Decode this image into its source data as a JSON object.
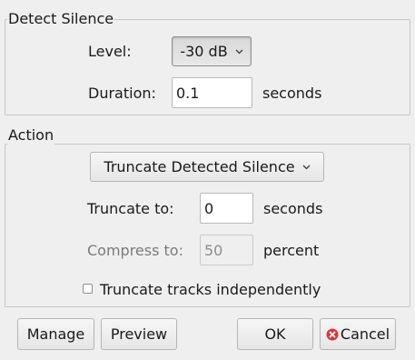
{
  "detect_group": {
    "title": "Detect Silence",
    "level_label": "Level:",
    "level_value": "-30 dB",
    "duration_label": "Duration:",
    "duration_value": "0.1",
    "duration_unit": "seconds"
  },
  "action_group": {
    "title": "Action",
    "action_value": "Truncate Detected Silence",
    "truncate_label": "Truncate to:",
    "truncate_value": "0",
    "truncate_unit": "seconds",
    "compress_label": "Compress to:",
    "compress_value": "50",
    "compress_unit": "percent",
    "independent_label": "Truncate tracks independently",
    "independent_checked": false
  },
  "buttons": {
    "manage": "Manage",
    "preview": "Preview",
    "ok": "OK",
    "cancel": "Cancel"
  },
  "icons": {
    "cancel": "cancel-icon",
    "dropdown": "chevron-down-icon"
  },
  "colors": {
    "cancel_icon": "#d9363e"
  }
}
